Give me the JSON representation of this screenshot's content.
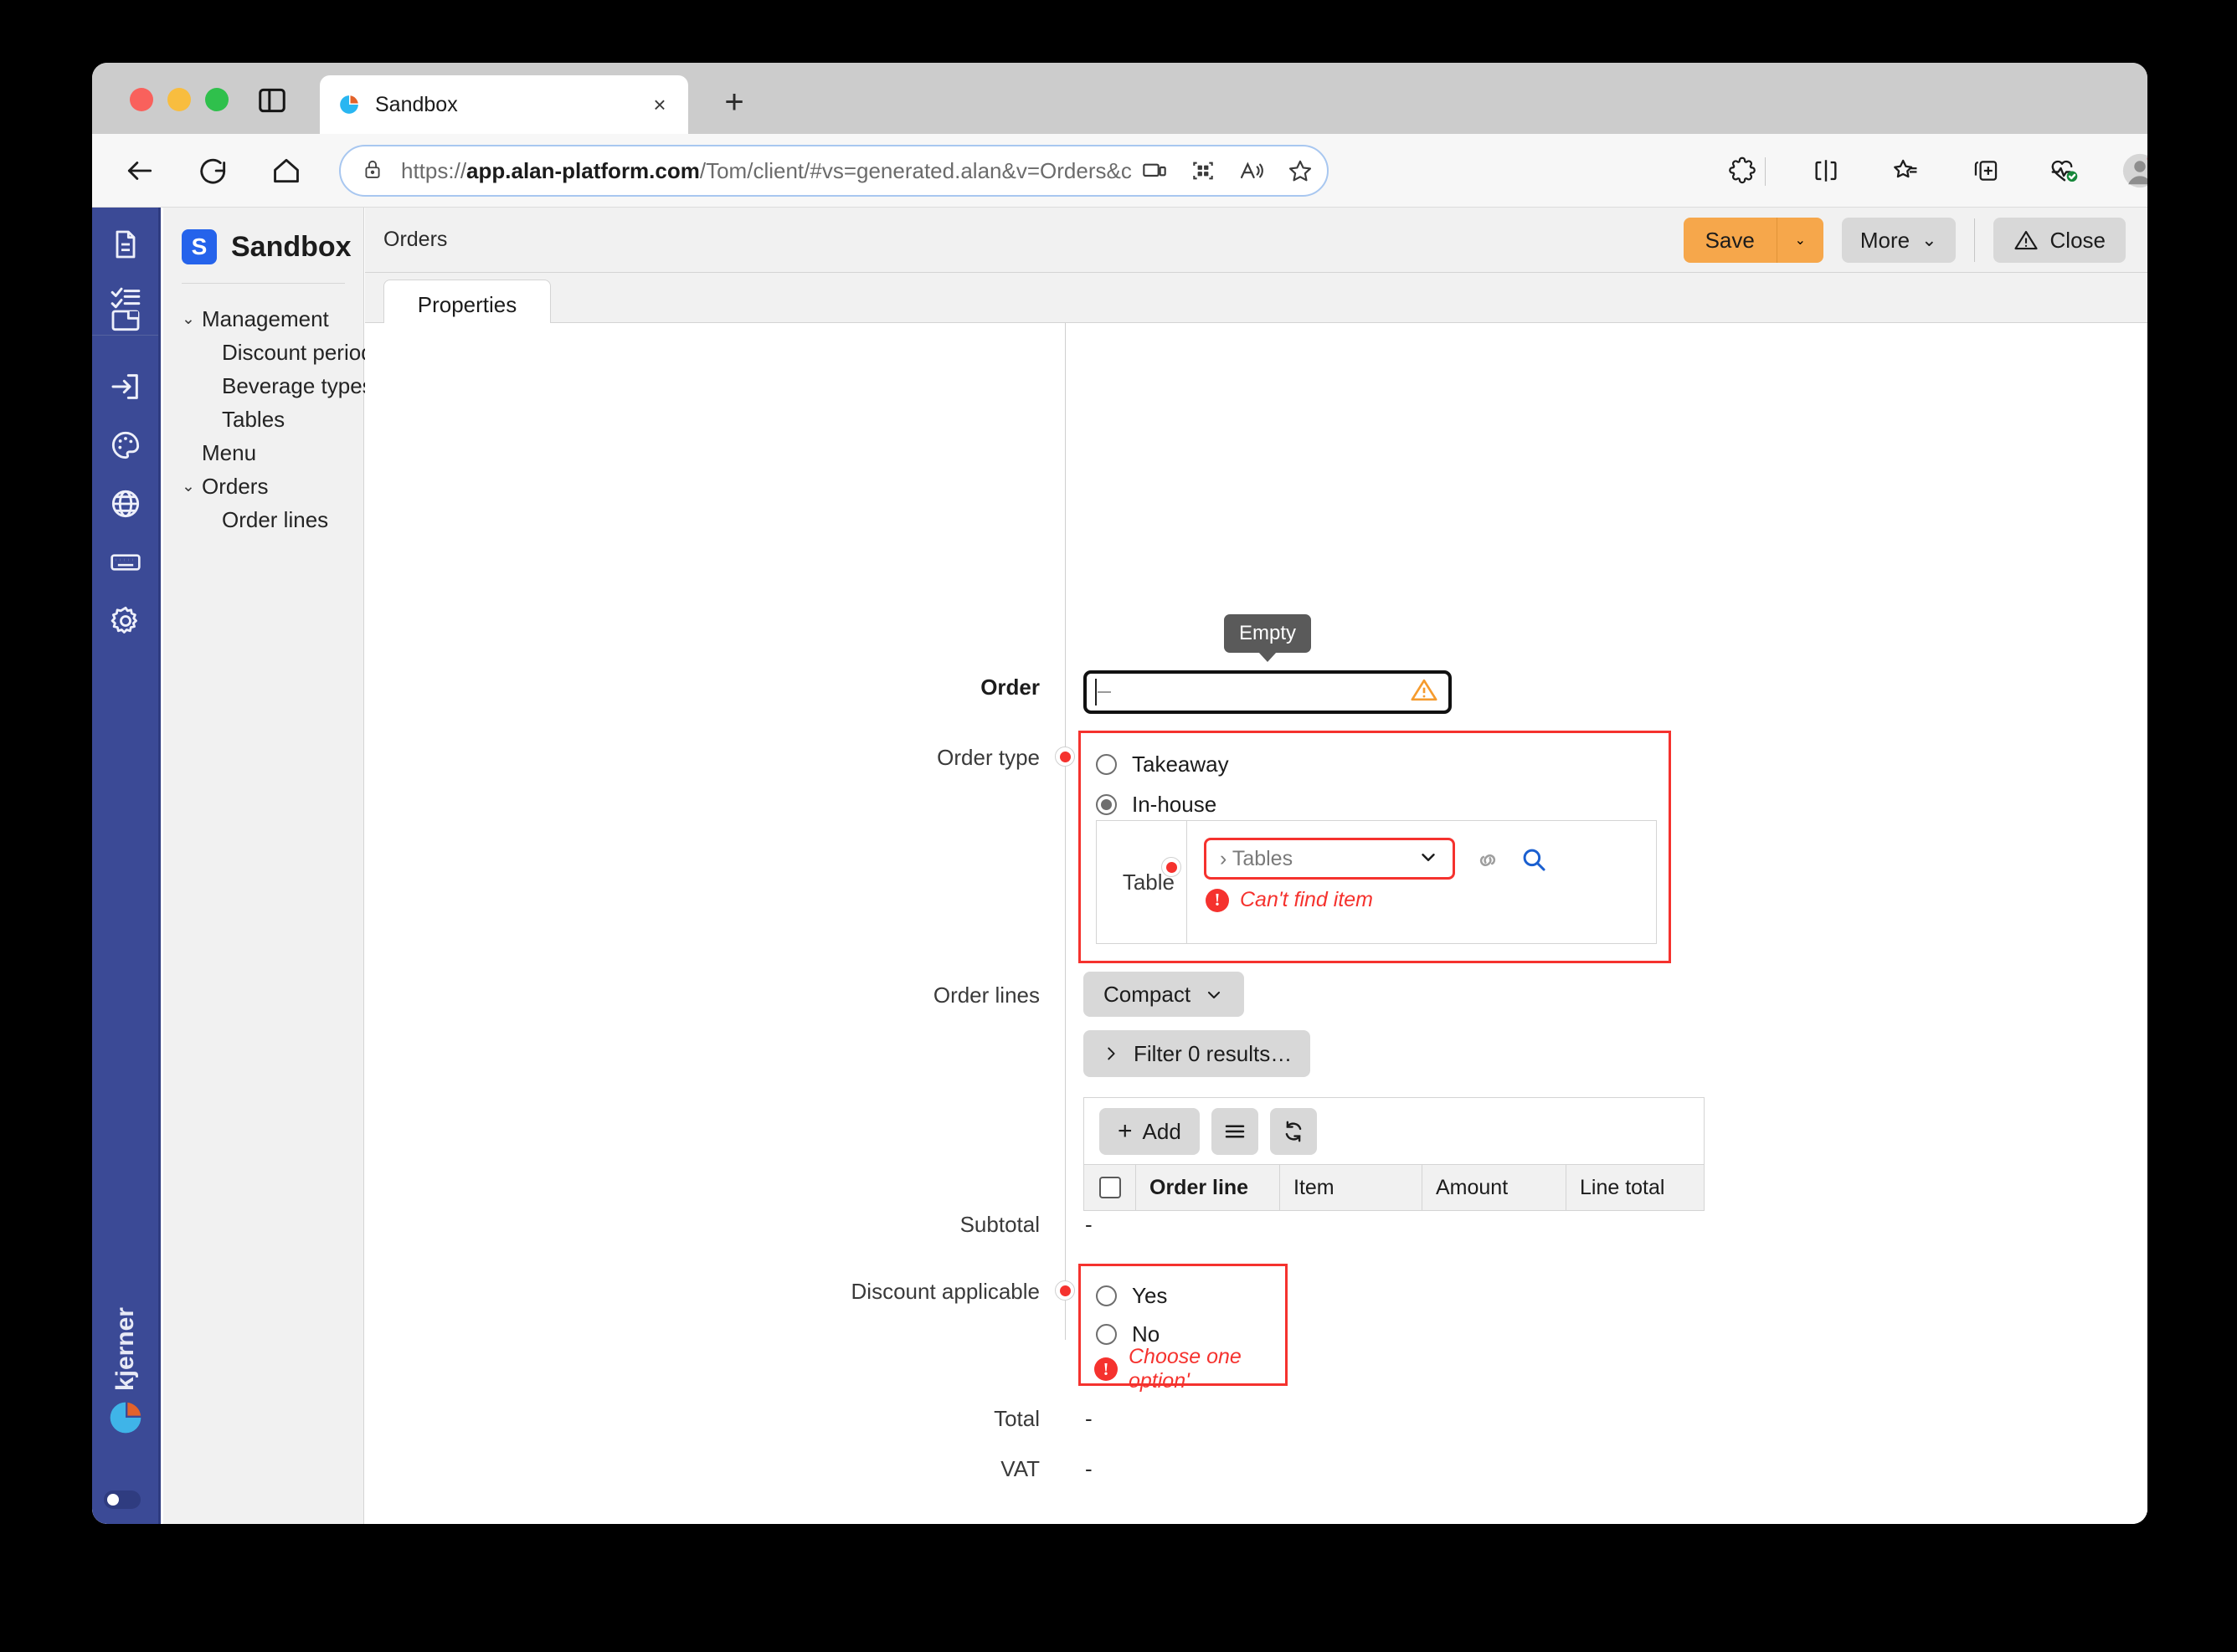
{
  "browser": {
    "tab_title": "Sandbox",
    "url_prefix": "https://",
    "url_domain": "app.alan-platform.com",
    "url_path": "/Tom/client/#vs=generated.alan&v=Orders&c=",
    "new_tab_glyph": "+",
    "tab_close_glyph": "×"
  },
  "rail": {
    "icons": [
      "document-icon",
      "checklist-icon",
      "folder-icon",
      "login-icon",
      "palette-icon",
      "globe-icon",
      "keyboard-icon",
      "gear-icon"
    ],
    "logo_wordmark": "kjerner"
  },
  "nav": {
    "brand_badge": "S",
    "brand_name": "Sandbox",
    "items": [
      {
        "label": "Management",
        "chevron": "⌄",
        "child": false
      },
      {
        "label": "Discount periods",
        "chevron": "",
        "child": true
      },
      {
        "label": "Beverage types",
        "chevron": "",
        "child": true
      },
      {
        "label": "Tables",
        "chevron": "",
        "child": true
      },
      {
        "label": "Menu",
        "chevron": "",
        "child": false
      },
      {
        "label": "Orders",
        "chevron": "⌄",
        "child": false
      },
      {
        "label": "Order lines",
        "chevron": "",
        "child": true
      }
    ]
  },
  "header": {
    "breadcrumb": "Orders",
    "save_label": "Save",
    "save_caret": "⌄",
    "more_label": "More",
    "more_caret": "⌄",
    "close_label": "Close"
  },
  "tabs": {
    "properties_label": "Properties"
  },
  "tooltip": {
    "text": "Empty"
  },
  "form": {
    "order": {
      "label": "Order",
      "value": "",
      "warning": "warning-triangle-icon"
    },
    "order_type": {
      "label": "Order type",
      "options": [
        {
          "label": "Takeaway",
          "checked": false
        },
        {
          "label": "In-house",
          "checked": true
        }
      ],
      "table": {
        "label": "Table",
        "value": "› Tables",
        "caret": "⌄",
        "error": "Can't find item",
        "error_glyph": "!"
      }
    },
    "order_lines": {
      "label": "Order lines",
      "compact_label": "Compact",
      "compact_caret": "⌄",
      "filter_label": "Filter 0 results…",
      "filter_caret": "›",
      "add_label": "Add",
      "add_plus": "+",
      "columns": [
        {
          "label": "",
          "width": 62,
          "bold": false
        },
        {
          "label": "Order line",
          "width": 172,
          "bold": true
        },
        {
          "label": "Item",
          "width": 170,
          "bold": false
        },
        {
          "label": "Amount",
          "width": 172,
          "bold": false
        },
        {
          "label": "Line total",
          "width": 164,
          "bold": false
        }
      ],
      "rows": []
    },
    "subtotal": {
      "label": "Subtotal",
      "value": "-"
    },
    "discount": {
      "label": "Discount applicable",
      "options": [
        {
          "label": "Yes",
          "checked": false
        },
        {
          "label": "No",
          "checked": false
        }
      ],
      "error": "Choose one option'",
      "error_glyph": "!"
    },
    "total": {
      "label": "Total",
      "value": "-"
    },
    "vat": {
      "label": "VAT",
      "value": "-"
    }
  },
  "colors": {
    "accent_save": "#f6a74b",
    "error": "#f5322e",
    "rail": "#3b4a96",
    "brand_badge": "#2563eb"
  }
}
